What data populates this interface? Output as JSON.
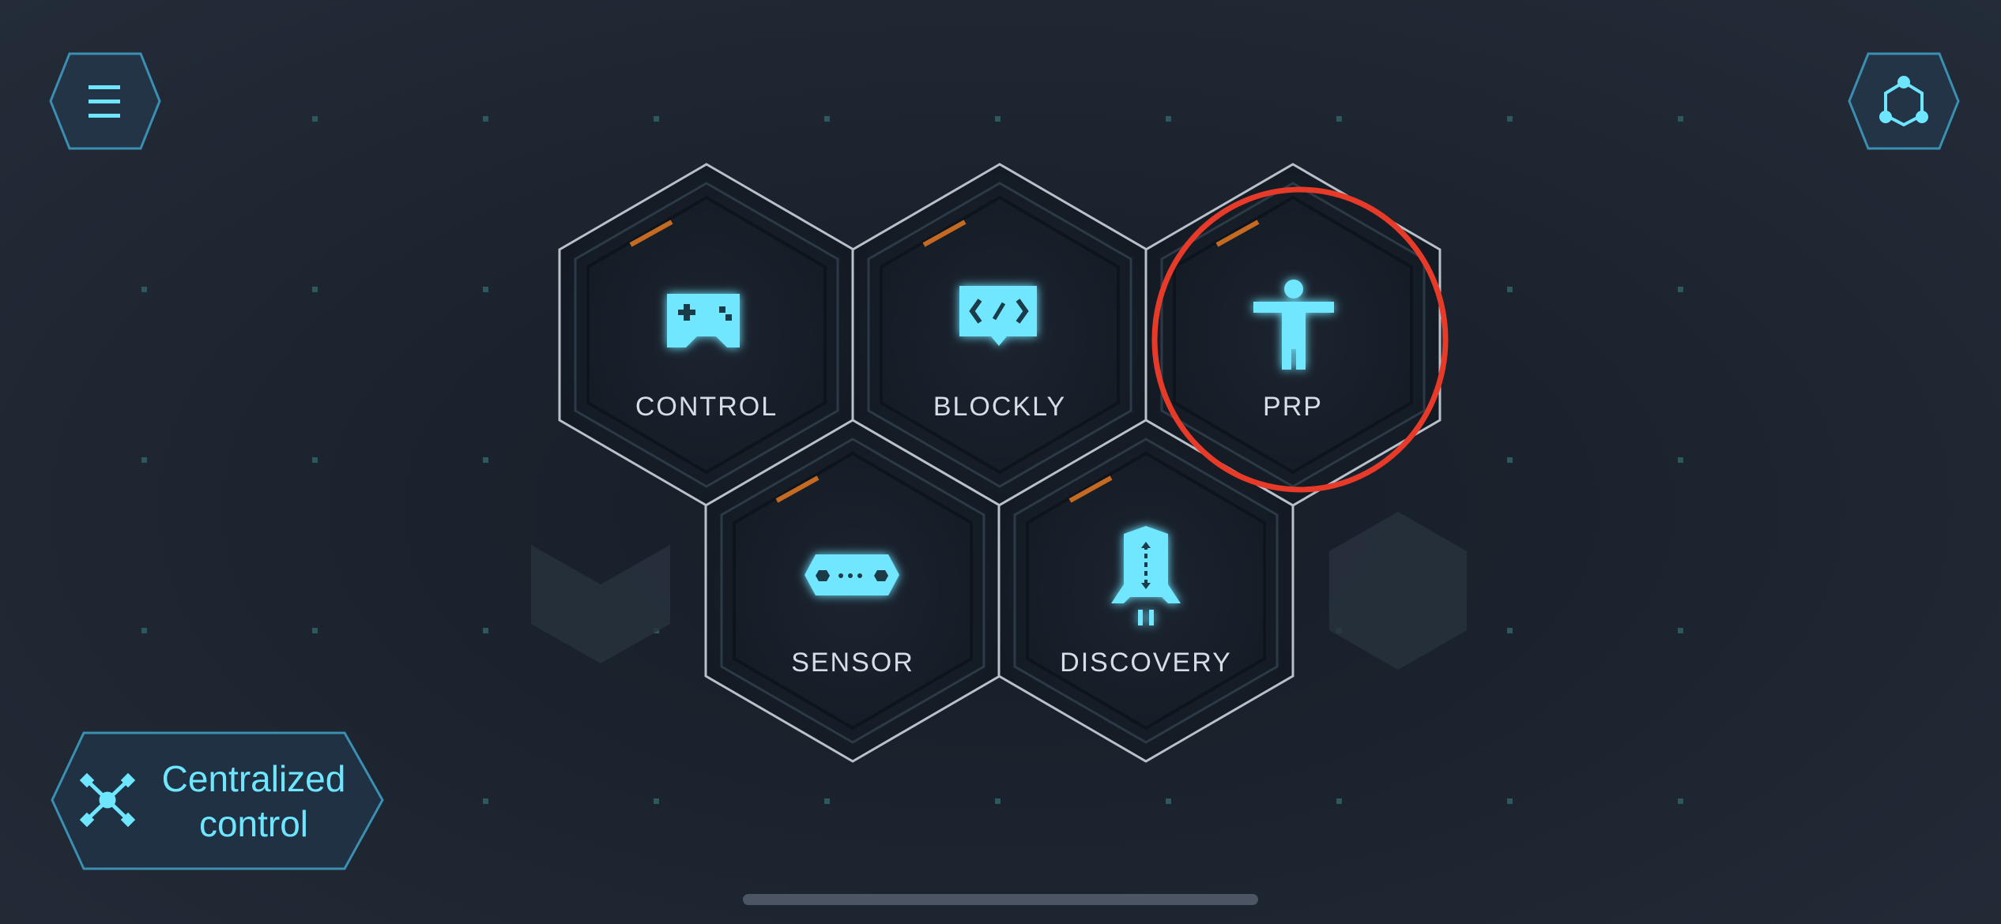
{
  "tiles": [
    {
      "id": "control",
      "label": "CONTROL",
      "icon": "gamepad-icon"
    },
    {
      "id": "blockly",
      "label": "BLOCKLY",
      "icon": "code-block-icon"
    },
    {
      "id": "prp",
      "label": "PRP",
      "icon": "person-icon"
    },
    {
      "id": "sensor",
      "label": "SENSOR",
      "icon": "sensor-icon"
    },
    {
      "id": "discovery",
      "label": "DISCOVERY",
      "icon": "rocket-icon"
    }
  ],
  "menu_button": {
    "icon": "menu-icon"
  },
  "connect_button": {
    "icon": "network-icon"
  },
  "centralized": {
    "line1": "Centralized",
    "line2": "control",
    "icon": "drone-icon"
  },
  "colors": {
    "accent": "#6fe6ff",
    "highlight_ring": "#e83a28",
    "tile_stripe": "#c46a22",
    "tile_border": "#b8c0ca"
  }
}
